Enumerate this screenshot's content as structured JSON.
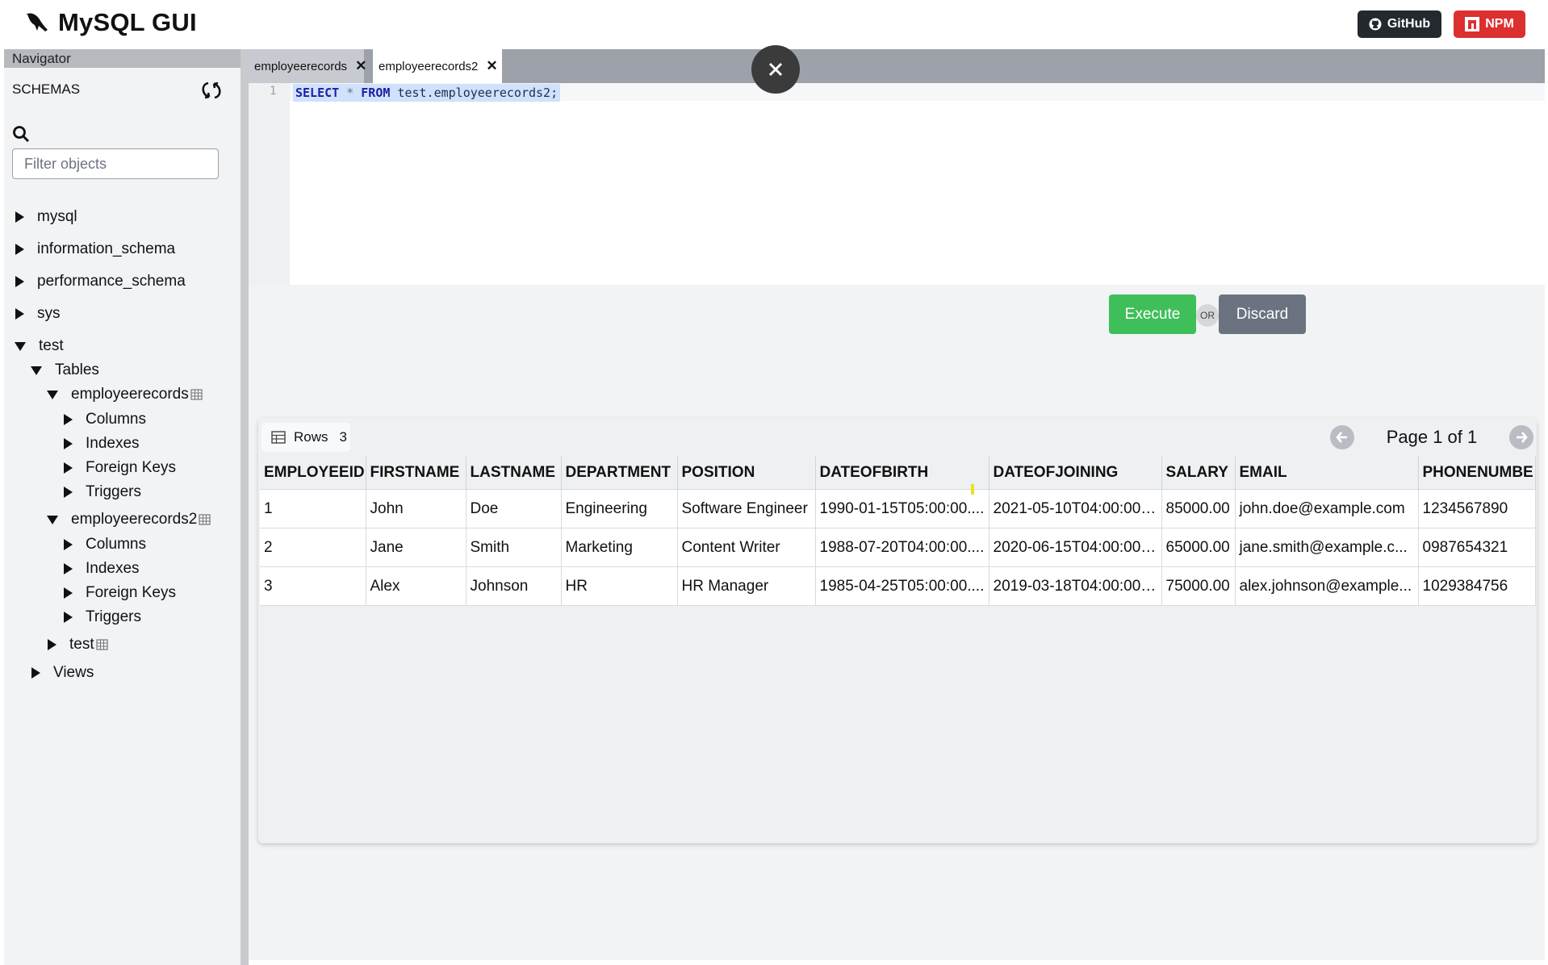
{
  "app": {
    "title": "MySQL GUI"
  },
  "header": {
    "github_label": "GitHub",
    "npm_label": "NPM"
  },
  "navigator": {
    "title": "Navigator",
    "schemas_label": "SCHEMAS",
    "filter_placeholder": "Filter objects",
    "tree": {
      "mysql": "mysql",
      "information_schema": "information_schema",
      "performance_schema": "performance_schema",
      "sys": "sys",
      "test": "test",
      "tables": "Tables",
      "t1": "employeerecords",
      "t2": "employeerecords2",
      "t3": "test",
      "columns": "Columns",
      "indexes": "Indexes",
      "foreign_keys": "Foreign Keys",
      "triggers": "Triggers",
      "views": "Views"
    }
  },
  "tabs": [
    {
      "label": "employeerecords"
    },
    {
      "label": "employeerecords2"
    }
  ],
  "editor": {
    "line_number": "1",
    "tokens": {
      "select": "SELECT",
      "star": "*",
      "from": "FROM",
      "target": "test.employeerecords2;"
    }
  },
  "actions": {
    "execute": "Execute",
    "or": "OR",
    "discard": "Discard"
  },
  "results": {
    "rows_label": "Rows",
    "rows_count": "3",
    "page_text": "Page 1 of 1",
    "columns": [
      "EMPLOYEEID",
      "FIRSTNAME",
      "LASTNAME",
      "DEPARTMENT",
      "POSITION",
      "DATEOFBIRTH",
      "DATEOFJOINING",
      "SALARY",
      "EMAIL",
      "PHONENUMBE"
    ],
    "rows": [
      [
        "1",
        "John",
        "Doe",
        "Engineering",
        "Software Engineer",
        "1990-01-15T05:00:00....",
        "2021-05-10T04:00:00....",
        "85000.00",
        "john.doe@example.com",
        "1234567890"
      ],
      [
        "2",
        "Jane",
        "Smith",
        "Marketing",
        "Content Writer",
        "1988-07-20T04:00:00....",
        "2020-06-15T04:00:00....",
        "65000.00",
        "jane.smith@example.c...",
        "0987654321"
      ],
      [
        "3",
        "Alex",
        "Johnson",
        "HR",
        "HR Manager",
        "1985-04-25T05:00:00....",
        "2019-03-18T04:00:00....",
        "75000.00",
        "alex.johnson@example...",
        "1029384756"
      ]
    ]
  },
  "colors": {
    "execute": "#3fbf59",
    "discard": "#6b7280",
    "github": "#24292f",
    "npm": "#dc2f2f"
  }
}
